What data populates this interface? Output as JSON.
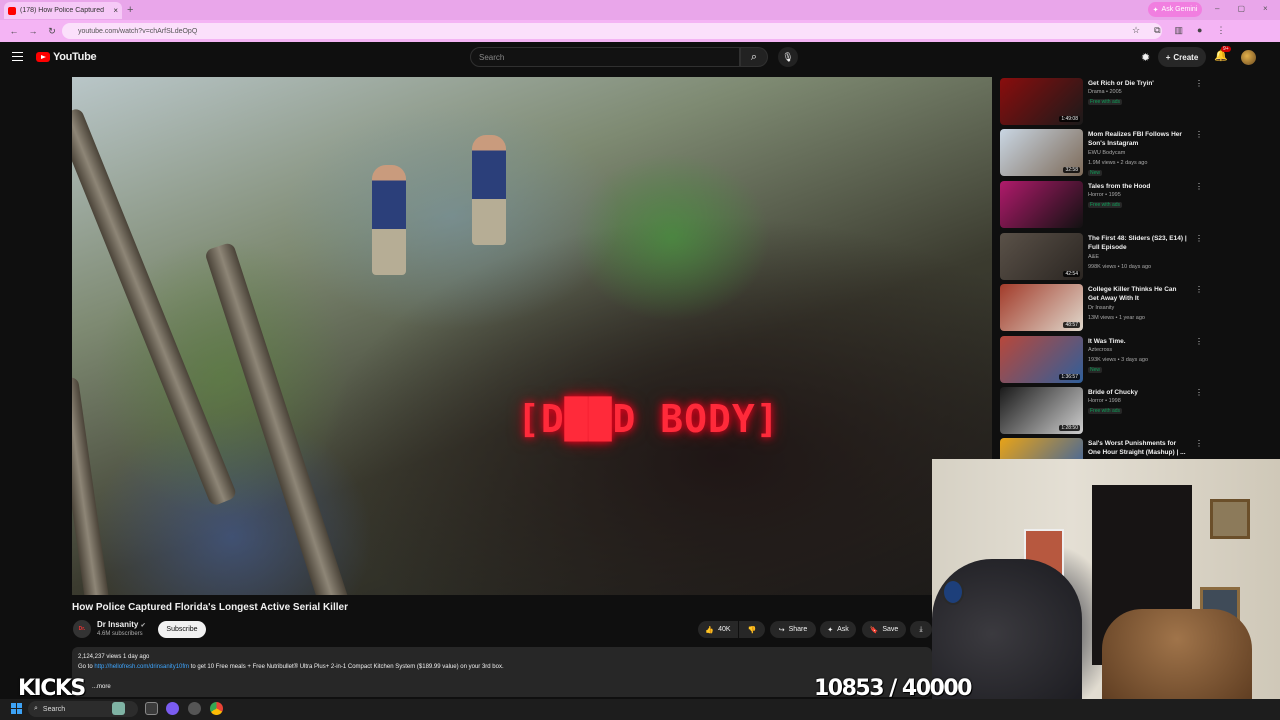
{
  "browser": {
    "tab_title": "(178) How Police Captured",
    "tab_close": "×",
    "new_tab": "+",
    "url": "youtube.com/watch?v=chArfSLdeOpQ",
    "ask_gemini": "Ask Gemini",
    "window_controls": [
      "–",
      "▢",
      "×"
    ]
  },
  "header": {
    "logo_text": "YouTube",
    "search_placeholder": "Search",
    "create_label": "Create",
    "notifications_badge": "9+"
  },
  "player": {
    "caption": "[D██D BODY]"
  },
  "video": {
    "title": "How Police Captured Florida's Longest Active Serial Killer",
    "channel_name": "Dr Insanity",
    "channel_avatar_text": "Dr.",
    "subscribers": "4.6M subscribers",
    "subscribe_label": "Subscribe",
    "likes": "40K",
    "share_label": "Share",
    "ask_label": "Ask",
    "save_label": "Save",
    "views_date": "2,124,237 views  1 day ago",
    "description_prefix": "Go to ",
    "description_link": "http://hellofresh.com/drinsanity10fm",
    "description_suffix": " to get 10 Free meals + Free Nutribullet® Ultra Plus+ 2-in-1 Compact Kitchen System ($189.99 value) on your 3rd box.",
    "more_label": "...more"
  },
  "recommendations": [
    {
      "title": "Get Rich or Die Tryin'",
      "channel": "Drama • 2005",
      "meta": "",
      "badge": "Free with ads",
      "duration": "1:49:08",
      "colors": [
        "#8a0d0d",
        "#1a1a1a"
      ]
    },
    {
      "title": "Mom Realizes FBI Follows Her Son's Instagram",
      "channel": "EWU Bodycam",
      "meta": "1.9M views • 2 days ago",
      "badge": "New",
      "duration": "32:58",
      "colors": [
        "#c9d6e3",
        "#7d6a58"
      ]
    },
    {
      "title": "Tales from the Hood",
      "channel": "Horror • 1995",
      "meta": "",
      "badge": "Free with ads",
      "duration": "",
      "colors": [
        "#b01a6b",
        "#111111"
      ]
    },
    {
      "title": "The First 48: Sliders (S23, E14) | Full Episode",
      "channel": "A&E",
      "meta": "998K views • 10 days ago",
      "badge": "",
      "duration": "42:54",
      "colors": [
        "#5a5148",
        "#2b2622"
      ]
    },
    {
      "title": "College Killer Thinks He Can Get Away With It",
      "channel": "Dr Insanity",
      "meta": "13M views • 1 year ago",
      "badge": "",
      "duration": "48:57",
      "colors": [
        "#a23b2a",
        "#e0d8cc"
      ]
    },
    {
      "title": "It Was Time.",
      "channel": "Aztecross",
      "meta": "193K views • 3 days ago",
      "badge": "New",
      "duration": "1:36:57",
      "colors": [
        "#b8473a",
        "#2f5f9b"
      ]
    },
    {
      "title": "Bride of Chucky",
      "channel": "Horror • 1998",
      "meta": "",
      "badge": "Free with ads",
      "duration": "1:28:50",
      "colors": [
        "#1a1a1a",
        "#cfcfcf"
      ]
    },
    {
      "title": "Sal's Worst Punishments for One Hour Straight (Mashup) | ...",
      "channel": "",
      "meta": "",
      "badge": "",
      "duration": "",
      "colors": [
        "#e8a317",
        "#2a5db0"
      ]
    }
  ],
  "overlay": {
    "kicks_label": "KICKS",
    "counter": "10853 / 40000"
  },
  "taskbar": {
    "search_label": "Search"
  }
}
